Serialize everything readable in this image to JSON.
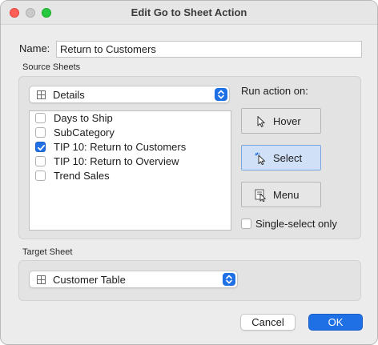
{
  "window": {
    "title": "Edit Go to Sheet Action"
  },
  "name_field": {
    "label": "Name:",
    "value": "Return to Customers"
  },
  "source_sheets": {
    "group_label": "Source Sheets",
    "dashboard_select": {
      "value": "Details",
      "icon": "grid-icon"
    },
    "sheets": [
      {
        "label": "Days to Ship",
        "checked": false
      },
      {
        "label": "SubCategory",
        "checked": false
      },
      {
        "label": "TIP 10: Return to Customers",
        "checked": true
      },
      {
        "label": "TIP 10: Return to Overview",
        "checked": false
      },
      {
        "label": "Trend Sales",
        "checked": false
      }
    ],
    "run_action_label": "Run action on:",
    "actions": [
      {
        "label": "Hover",
        "icon": "hover-pointer-icon",
        "active": false
      },
      {
        "label": "Select",
        "icon": "select-pointer-icon",
        "active": true
      },
      {
        "label": "Menu",
        "icon": "menu-pointer-icon",
        "active": false
      }
    ],
    "single_select_label": "Single-select only",
    "single_select_checked": false
  },
  "target_sheet": {
    "group_label": "Target Sheet",
    "select": {
      "value": "Customer Table",
      "icon": "grid-icon"
    }
  },
  "buttons": {
    "cancel": "Cancel",
    "ok": "OK"
  },
  "colors": {
    "accent": "#1f6fe5",
    "close": "#ff5f57",
    "maximize": "#28c840"
  }
}
